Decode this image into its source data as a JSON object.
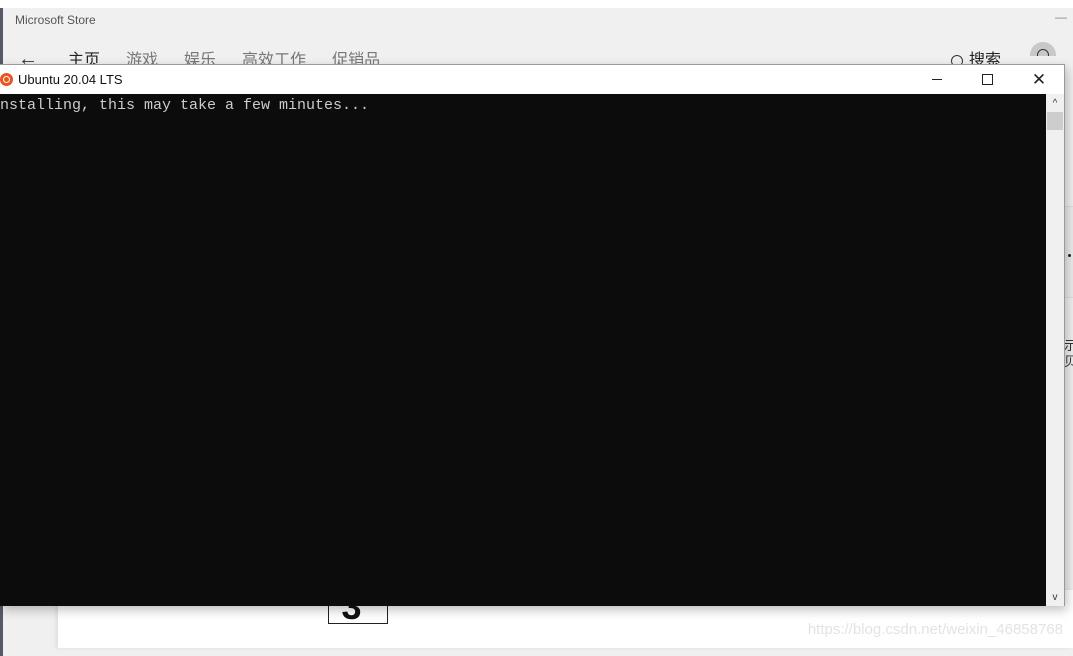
{
  "store": {
    "title": "Microsoft Store",
    "minimize_glyph": "—",
    "back_glyph": "←",
    "nav": [
      {
        "label": "主页"
      },
      {
        "label": "游戏"
      },
      {
        "label": "娱乐"
      },
      {
        "label": "高效工作"
      },
      {
        "label": "促销品"
      }
    ],
    "search_label": "搜索",
    "age_rating": "3",
    "age_rating_plus": "+",
    "right_edge_text": "示\n贝"
  },
  "console": {
    "title": "Ubuntu 20.04 LTS",
    "icon": "ubuntu-logo-icon",
    "close_glyph": "✕",
    "terminal_lines": [
      "nstalling, this may take a few minutes..."
    ],
    "scroll_up_glyph": "^",
    "scroll_down_glyph": "v"
  },
  "watermark": "https://blog.csdn.net/weixin_46858768"
}
